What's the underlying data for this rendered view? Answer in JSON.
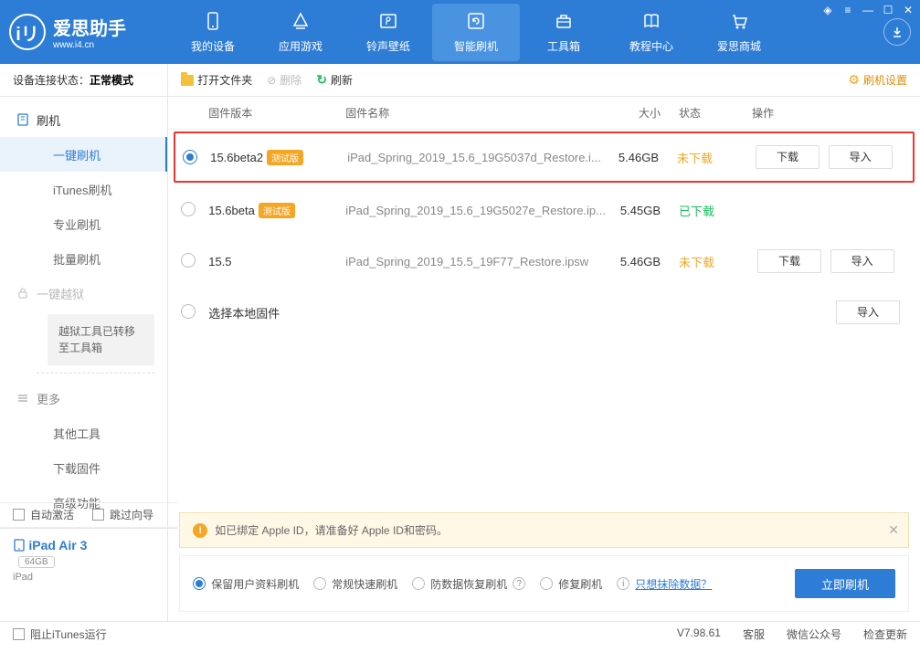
{
  "app": {
    "name": "爱思助手",
    "site": "www.i4.cn"
  },
  "nav": [
    {
      "label": "我的设备"
    },
    {
      "label": "应用游戏"
    },
    {
      "label": "铃声壁纸"
    },
    {
      "label": "智能刷机"
    },
    {
      "label": "工具箱"
    },
    {
      "label": "教程中心"
    },
    {
      "label": "爱思商城"
    }
  ],
  "status": {
    "prefix": "设备连接状态：",
    "mode": "正常模式"
  },
  "sidebar": {
    "flash": "刷机",
    "one_click": "一键刷机",
    "itunes": "iTunes刷机",
    "pro": "专业刷机",
    "batch": "批量刷机",
    "jailbreak": "一键越狱",
    "jb_note": "越狱工具已转移至工具箱",
    "more": "更多",
    "other_tools": "其他工具",
    "download_fw": "下载固件",
    "advanced": "高级功能"
  },
  "toolbar": {
    "open_folder": "打开文件夹",
    "delete": "删除",
    "refresh": "刷新",
    "settings": "刷机设置"
  },
  "columns": {
    "version": "固件版本",
    "name": "固件名称",
    "size": "大小",
    "status": "状态",
    "ops": "操作"
  },
  "rows": [
    {
      "version": "15.6beta2",
      "beta": "测试版",
      "name": "iPad_Spring_2019_15.6_19G5037d_Restore.i...",
      "size": "5.46GB",
      "status": "未下载",
      "status_class": "orange",
      "selected": true,
      "show_ops": true
    },
    {
      "version": "15.6beta",
      "beta": "测试版",
      "name": "iPad_Spring_2019_15.6_19G5027e_Restore.ip...",
      "size": "5.45GB",
      "status": "已下载",
      "status_class": "green",
      "selected": false,
      "show_ops": false
    },
    {
      "version": "15.5",
      "beta": "",
      "name": "iPad_Spring_2019_15.5_19F77_Restore.ipsw",
      "size": "5.46GB",
      "status": "未下载",
      "status_class": "orange",
      "selected": false,
      "show_ops": true
    }
  ],
  "local_row": "选择本地固件",
  "btn": {
    "download": "下载",
    "import": "导入"
  },
  "warning": "如已绑定 Apple ID，请准备好 Apple ID和密码。",
  "options": {
    "keep_data": "保留用户资料刷机",
    "normal": "常规快速刷机",
    "recovery": "防数据恢复刷机",
    "repair": "修复刷机",
    "erase": "只想抹除数据？",
    "go": "立即刷机"
  },
  "checks": {
    "auto_activate": "自动激活",
    "skip_guide": "跳过向导"
  },
  "device": {
    "name": "iPad Air 3",
    "capacity": "64GB",
    "type": "iPad"
  },
  "footer": {
    "block_itunes": "阻止iTunes运行",
    "version": "V7.98.61",
    "service": "客服",
    "wechat": "微信公众号",
    "update": "检查更新"
  }
}
